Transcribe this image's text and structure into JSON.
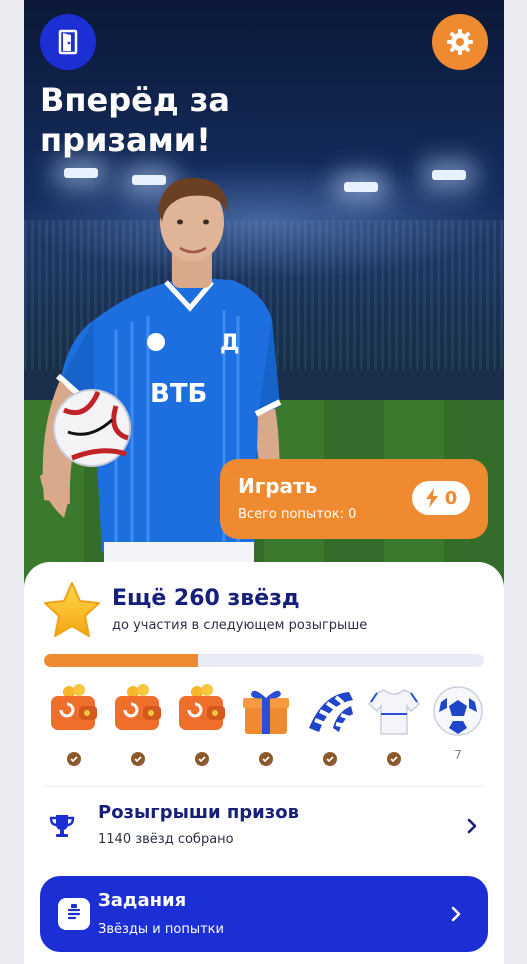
{
  "header": {
    "title_line1": "Вперёд за",
    "title_line2": "призами!",
    "exit_icon": "door-icon",
    "settings_icon": "gear-icon"
  },
  "hero": {
    "jersey_sponsor": "ВТБ"
  },
  "play": {
    "label": "Играть",
    "attempts_text": "Всего попыток: 0",
    "energy_icon": "lightning-icon",
    "energy_count": "0"
  },
  "stars": {
    "title": "Ещё 260 звёзд",
    "subtitle": "до участия в следующем розыгрыше",
    "progress": 0.35
  },
  "rewards": [
    {
      "name": "wallet",
      "collected": true,
      "label": ""
    },
    {
      "name": "wallet",
      "collected": true,
      "label": ""
    },
    {
      "name": "wallet",
      "collected": true,
      "label": ""
    },
    {
      "name": "gift",
      "collected": true,
      "label": ""
    },
    {
      "name": "scarf",
      "collected": true,
      "label": ""
    },
    {
      "name": "jersey",
      "collected": true,
      "label": ""
    },
    {
      "name": "ball",
      "collected": false,
      "label": "7"
    }
  ],
  "draws": {
    "title": "Розыгрыши призов",
    "subtitle": "1140 звёзд собрано",
    "icon": "trophy-icon"
  },
  "tasks": {
    "title": "Задания",
    "subtitle": "Звёзды и попытки",
    "icon": "clipboard-icon"
  },
  "colors": {
    "brand_blue": "#1b2fd4",
    "accent_orange": "#f08a30",
    "title_navy": "#16207a"
  }
}
